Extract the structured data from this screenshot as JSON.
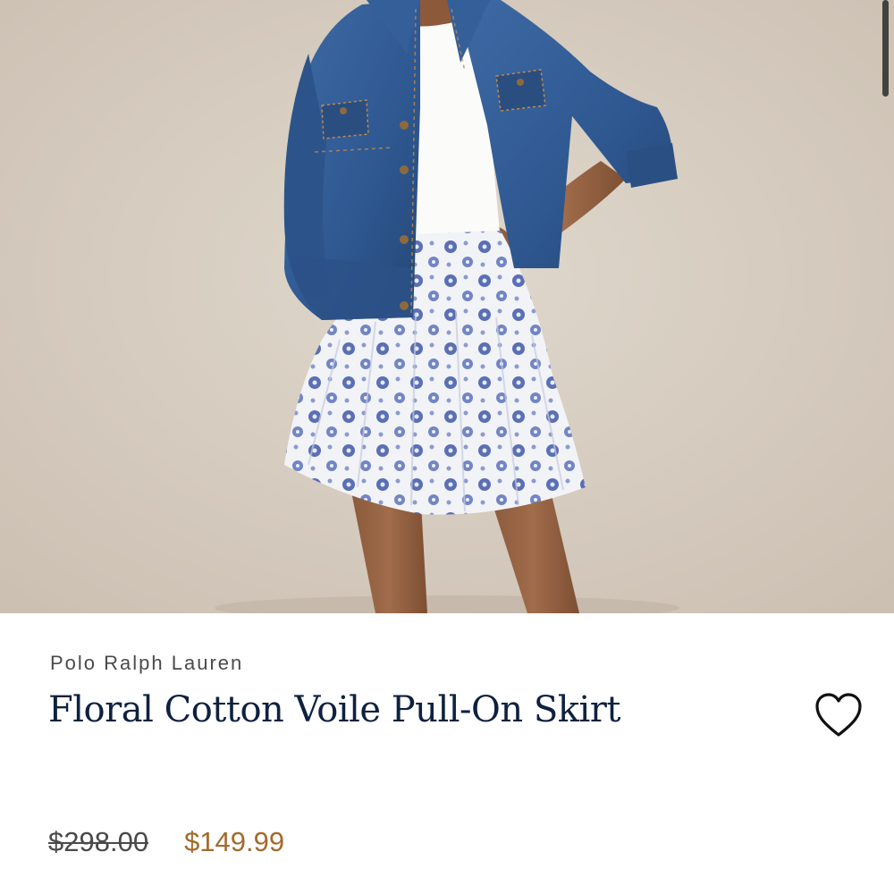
{
  "product": {
    "image_alt": "Model wearing denim jacket, white tee and floral pleated mini skirt",
    "brand": "Polo Ralph Lauren",
    "title": "Floral Cotton Voile Pull-On Skirt",
    "price_original": "$298.00",
    "price_sale": "$149.99",
    "wishlist_icon": "heart-outline-icon"
  },
  "colors": {
    "title": "#0f2140",
    "sale_price": "#a36a2c",
    "brand_text": "#4a4a4a",
    "image_background": "#d3c9bd"
  }
}
